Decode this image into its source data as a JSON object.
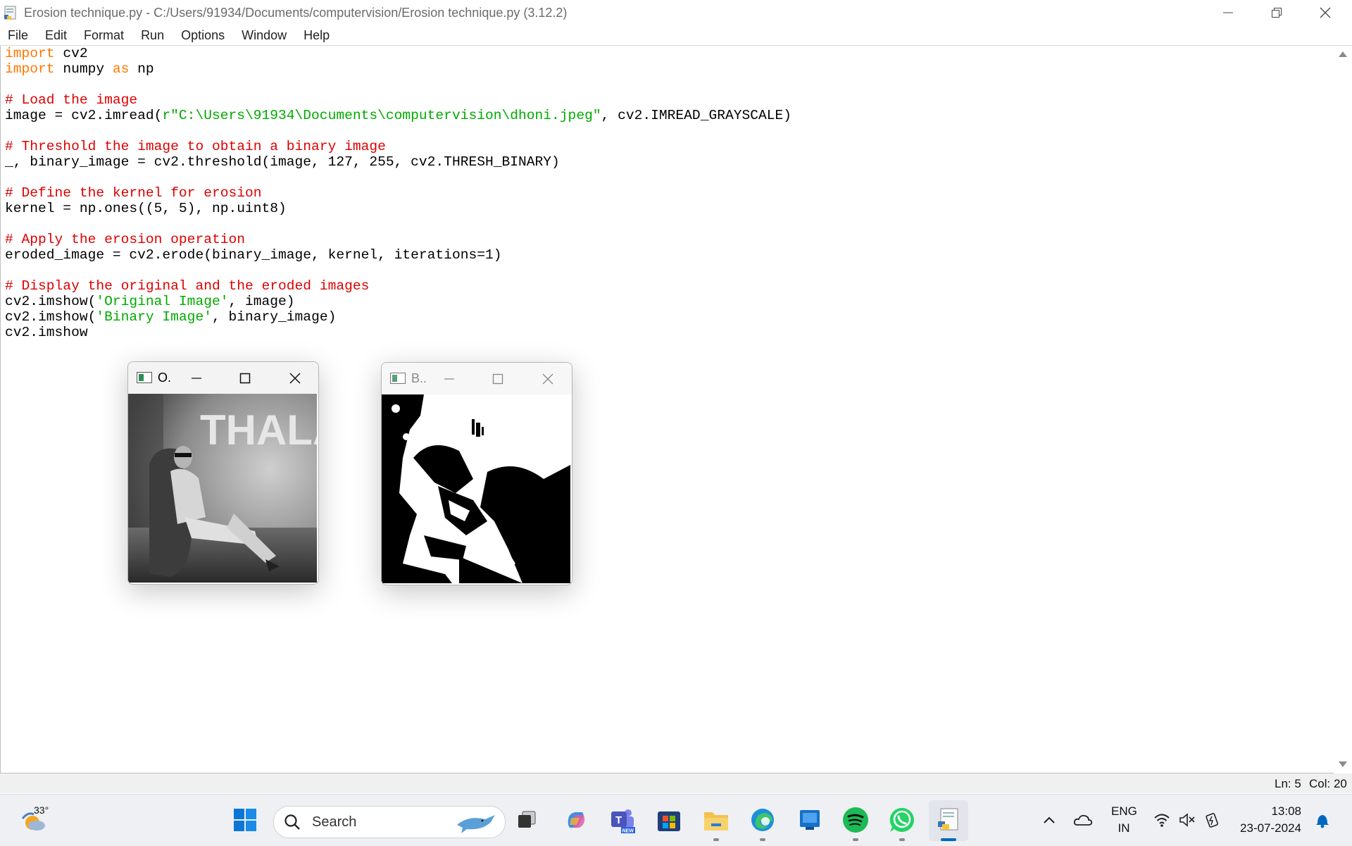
{
  "window": {
    "title": "Erosion technique.py - C:/Users/91934/Documents/computervision/Erosion technique.py (3.12.2)"
  },
  "menubar": {
    "items": [
      "File",
      "Edit",
      "Format",
      "Run",
      "Options",
      "Window",
      "Help"
    ]
  },
  "editor": {
    "lines": [
      [
        {
          "t": "import",
          "c": "kw"
        },
        {
          "t": " cv2",
          "c": ""
        }
      ],
      [
        {
          "t": "import",
          "c": "kw"
        },
        {
          "t": " numpy ",
          "c": ""
        },
        {
          "t": "as",
          "c": "kw"
        },
        {
          "t": " np",
          "c": ""
        }
      ],
      [],
      [
        {
          "t": "# Load the image",
          "c": "cm"
        }
      ],
      [
        {
          "t": "image = cv2.imread(",
          "c": ""
        },
        {
          "t": "r\"C:\\Users\\91934\\Documents\\computervision\\dhoni.jpeg\"",
          "c": "st"
        },
        {
          "t": ", cv2.IMREAD_GRAYSCALE)",
          "c": ""
        }
      ],
      [],
      [
        {
          "t": "# Threshold the image to obtain a binary image",
          "c": "cm"
        }
      ],
      [
        {
          "t": "_, binary_image = cv2.threshold(image, 127, 255, cv2.THRESH_BINARY)",
          "c": ""
        }
      ],
      [],
      [
        {
          "t": "# Define the kernel for erosion",
          "c": "cm"
        }
      ],
      [
        {
          "t": "kernel = np.ones((5, 5), np.uint8)",
          "c": ""
        }
      ],
      [],
      [
        {
          "t": "# Apply the erosion operation",
          "c": "cm"
        }
      ],
      [
        {
          "t": "eroded_image = cv2.erode(binary_image, kernel, iterations=1)",
          "c": ""
        }
      ],
      [],
      [
        {
          "t": "# Display the original and the eroded images",
          "c": "cm"
        }
      ],
      [
        {
          "t": "cv2.imshow(",
          "c": ""
        },
        {
          "t": "'Original Image'",
          "c": "st"
        },
        {
          "t": ", image)",
          "c": ""
        }
      ],
      [
        {
          "t": "cv2.imshow(",
          "c": ""
        },
        {
          "t": "'Binary Image'",
          "c": "st"
        },
        {
          "t": ", binary_image)",
          "c": ""
        }
      ],
      [
        {
          "t": "cv2.imshow",
          "c": ""
        }
      ]
    ]
  },
  "status": {
    "ln": "Ln: 5",
    "col": "Col: 20"
  },
  "cv_windows": {
    "original": {
      "title": "O.",
      "image_text": "THALA",
      "image_desc": "grayscale-photo"
    },
    "binary": {
      "title": "B..",
      "image_desc": "binary-threshold-photo"
    }
  },
  "taskbar": {
    "weather_temp": "33°",
    "search_label": "Search",
    "lang_line1": "ENG",
    "lang_line2": "IN",
    "time": "13:08",
    "date": "23-07-2024",
    "apps": [
      "start-icon",
      "search",
      "task-view-icon",
      "copilot-icon",
      "teams-icon",
      "store-icon",
      "file-explorer-icon",
      "edge-icon",
      "app-icon",
      "spotify-icon",
      "whatsapp-icon",
      "python-idle-icon"
    ]
  },
  "colors": {
    "keyword": "#ff7700",
    "comment": "#dd0000",
    "string": "#00aa00",
    "accent": "#0067c0"
  }
}
